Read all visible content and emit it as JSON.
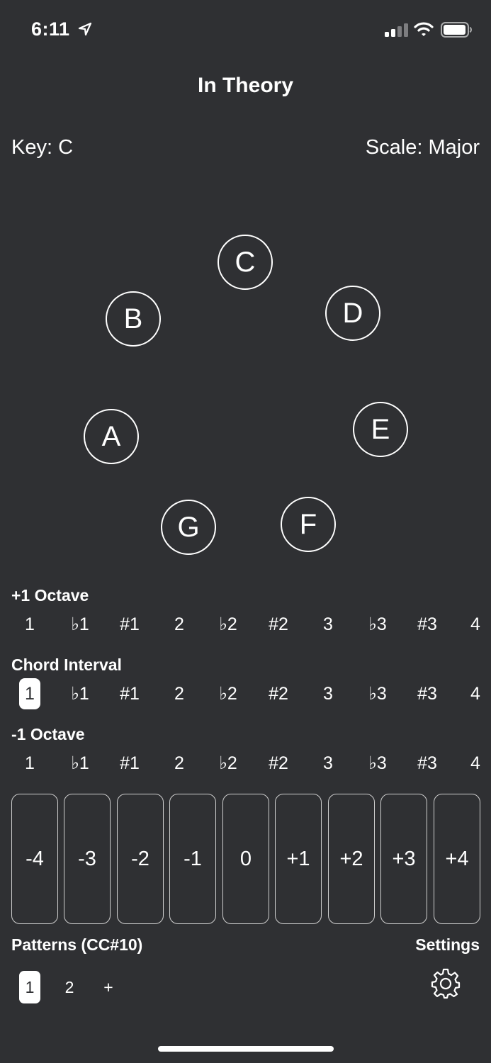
{
  "status_bar": {
    "time": "6:11",
    "location_icon": "location-arrow-icon",
    "signal_icon": "cellular-signal-icon",
    "wifi_icon": "wifi-icon",
    "battery_icon": "battery-icon"
  },
  "header": {
    "title": "In Theory"
  },
  "key_label": "Key: C",
  "scale_label": "Scale: Major",
  "notes": [
    "C",
    "D",
    "E",
    "F",
    "G",
    "A",
    "B"
  ],
  "plus_octave": {
    "label": "+1 Octave",
    "intervals": [
      "1",
      "♭1",
      "#1",
      "2",
      "♭2",
      "#2",
      "3",
      "♭3",
      "#3",
      "4"
    ]
  },
  "chord_interval": {
    "label": "Chord Interval",
    "intervals": [
      "1",
      "♭1",
      "#1",
      "2",
      "♭2",
      "#2",
      "3",
      "♭3",
      "#3",
      "4"
    ],
    "selected": "1"
  },
  "minus_octave": {
    "label": "-1 Octave",
    "intervals": [
      "1",
      "♭1",
      "#1",
      "2",
      "♭2",
      "#2",
      "3",
      "♭3",
      "#3",
      "4"
    ]
  },
  "offsets": [
    "-4",
    "-3",
    "-2",
    "-1",
    "0",
    "+1",
    "+2",
    "+3",
    "+4"
  ],
  "patterns": {
    "label": "Patterns (CC#10)",
    "items": [
      "1",
      "2"
    ],
    "add_label": "+",
    "selected": "1"
  },
  "settings": {
    "label": "Settings",
    "icon": "gear-icon"
  },
  "colors": {
    "background": "#2f3033",
    "foreground": "#ffffff"
  }
}
